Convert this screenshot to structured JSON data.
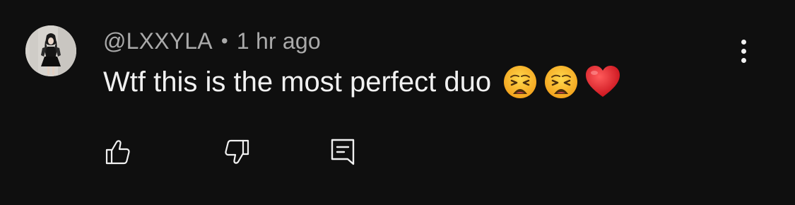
{
  "comment": {
    "author": "@LXXYLA",
    "separator": "•",
    "timestamp": "1 hr ago",
    "text": "Wtf this is the most perfect duo",
    "emojis": [
      "weary-face",
      "weary-face",
      "red-heart"
    ]
  },
  "actions": {
    "like_icon": "thumb-up-icon",
    "dislike_icon": "thumb-down-icon",
    "reply_icon": "comment-reply-icon",
    "more_icon": "more-vertical-icon"
  },
  "colors": {
    "background": "#0f0f0f",
    "meta_text": "#aaaaaa",
    "primary_text": "#f1f1f1"
  }
}
